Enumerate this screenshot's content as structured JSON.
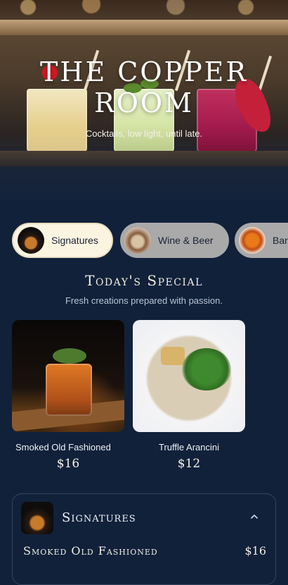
{
  "hero": {
    "title": "THE COPPER ROOM",
    "tagline": "Cocktails, low light, until late."
  },
  "categories": [
    {
      "label": "Signatures",
      "icon": "signature-cocktail-thumb",
      "selected": true
    },
    {
      "label": "Wine & Beer",
      "icon": "wine-beer-thumb",
      "selected": false
    },
    {
      "label": "Bar",
      "icon": "bar-bites-thumb",
      "selected": false
    }
  ],
  "special": {
    "title": "Today's Special",
    "subtitle": "Fresh creations prepared with passion.",
    "items": [
      {
        "name": "Smoked Old Fashioned",
        "price": "$16"
      },
      {
        "name": "Truffle Arancini",
        "price": "$12"
      }
    ]
  },
  "menu_section": {
    "title": "Signatures",
    "expanded": true,
    "chevron_icon": "chevron-up-icon",
    "items": [
      {
        "name": "Smoked Old Fashioned",
        "price": "$16"
      }
    ]
  },
  "colors": {
    "background": "#11213a",
    "chip_active": "#fbf4e1",
    "chip_inactive": "#a9a9aa"
  }
}
